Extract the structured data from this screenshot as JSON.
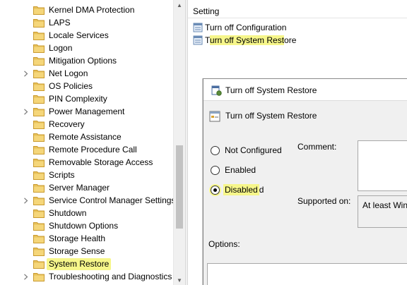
{
  "tree": {
    "items": [
      {
        "label": "Kernel DMA Protection",
        "expandable": false
      },
      {
        "label": "LAPS",
        "expandable": false
      },
      {
        "label": "Locale Services",
        "expandable": false
      },
      {
        "label": "Logon",
        "expandable": false
      },
      {
        "label": "Mitigation Options",
        "expandable": false
      },
      {
        "label": "Net Logon",
        "expandable": true
      },
      {
        "label": "OS Policies",
        "expandable": false
      },
      {
        "label": "PIN Complexity",
        "expandable": false
      },
      {
        "label": "Power Management",
        "expandable": true
      },
      {
        "label": "Recovery",
        "expandable": false
      },
      {
        "label": "Remote Assistance",
        "expandable": false
      },
      {
        "label": "Remote Procedure Call",
        "expandable": false
      },
      {
        "label": "Removable Storage Access",
        "expandable": false
      },
      {
        "label": "Scripts",
        "expandable": false
      },
      {
        "label": "Server Manager",
        "expandable": false
      },
      {
        "label": "Service Control Manager Settings",
        "expandable": true
      },
      {
        "label": "Shutdown",
        "expandable": false
      },
      {
        "label": "Shutdown Options",
        "expandable": false
      },
      {
        "label": "Storage Health",
        "expandable": false
      },
      {
        "label": "Storage Sense",
        "expandable": false
      },
      {
        "label": "System Restore",
        "expandable": false,
        "selected": true
      },
      {
        "label": "Troubleshooting and Diagnostics",
        "expandable": true
      }
    ]
  },
  "settings": {
    "header": "Setting",
    "rows": [
      {
        "label": "Turn off Configuration"
      },
      {
        "label_pre": "T",
        "label_hl": "urn off System Rest",
        "label_post": "ore"
      }
    ]
  },
  "dialog": {
    "title": "Turn off System Restore",
    "policy_title": "Turn off System Restore",
    "options": {
      "not_configured": "Not Configured",
      "enabled": "Enabled",
      "disabled_hl": "Disabled",
      "disabled_post": "d",
      "selected": "disabled"
    },
    "comment_label": "Comment:",
    "supported_label": "Supported on:",
    "supported_value": "At least Win",
    "options_label": "Options:"
  },
  "colors": {
    "highlight": "#f6f68a",
    "folder": "#e8c15a"
  },
  "icons": {
    "folder": "folder-icon",
    "expand": "chevron-right-icon",
    "setting": "policy-setting-icon",
    "dialog": "policy-dialog-icon"
  }
}
